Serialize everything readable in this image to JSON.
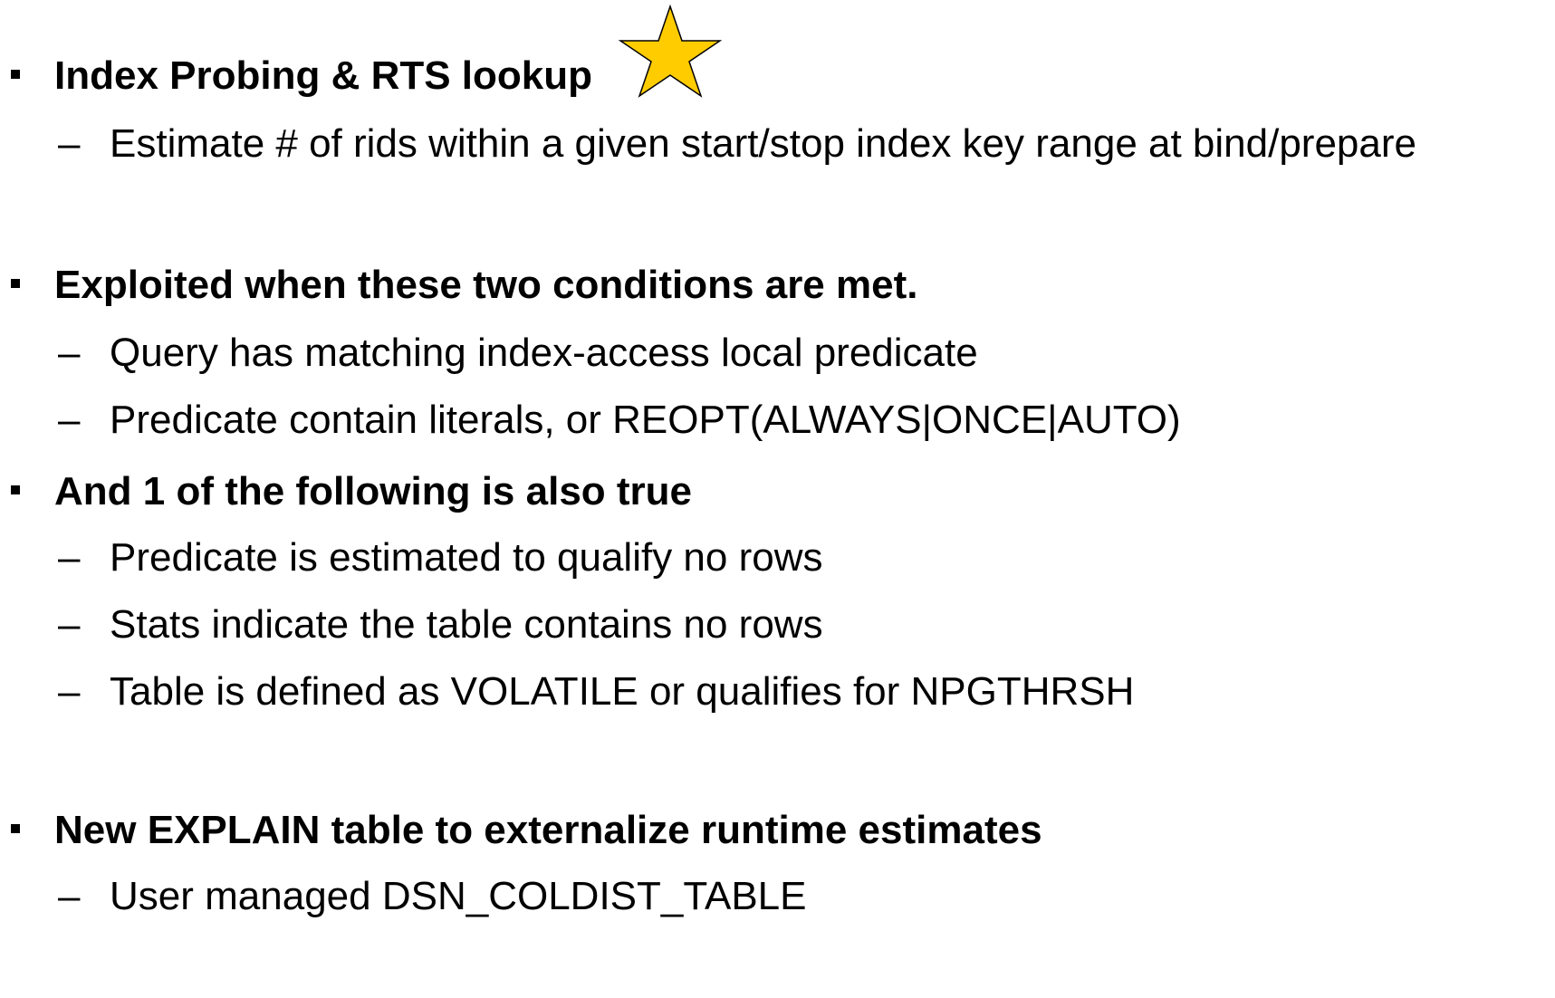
{
  "items": [
    {
      "level": 1,
      "text": "Index Probing & RTS lookup"
    },
    {
      "level": 2,
      "text": "Estimate # of rids within a given start/stop index key range at bind/prepare"
    },
    {
      "level": 1,
      "text": "Exploited when these two conditions are met."
    },
    {
      "level": 2,
      "text": "Query has matching index-access local predicate"
    },
    {
      "level": 2,
      "text": "Predicate contain literals, or REOPT(ALWAYS|ONCE|AUTO)"
    },
    {
      "level": 1,
      "text": "And 1 of the following is also true"
    },
    {
      "level": 2,
      "text": "Predicate is estimated to qualify no rows"
    },
    {
      "level": 2,
      "text": "Stats indicate the table contains no rows"
    },
    {
      "level": 2,
      "text": "Table is defined as VOLATILE or qualifies for NPGTHRSH"
    },
    {
      "level": 1,
      "text": "New EXPLAIN table to externalize runtime estimates"
    },
    {
      "level": 2,
      "text": "User managed DSN_COLDIST_TABLE"
    }
  ],
  "dash_glyph": "–",
  "colors": {
    "star_fill": "#FFCC00",
    "star_stroke": "#000000",
    "text": "#000000",
    "background": "#FFFFFF"
  },
  "icons": {
    "star": "star-icon"
  }
}
